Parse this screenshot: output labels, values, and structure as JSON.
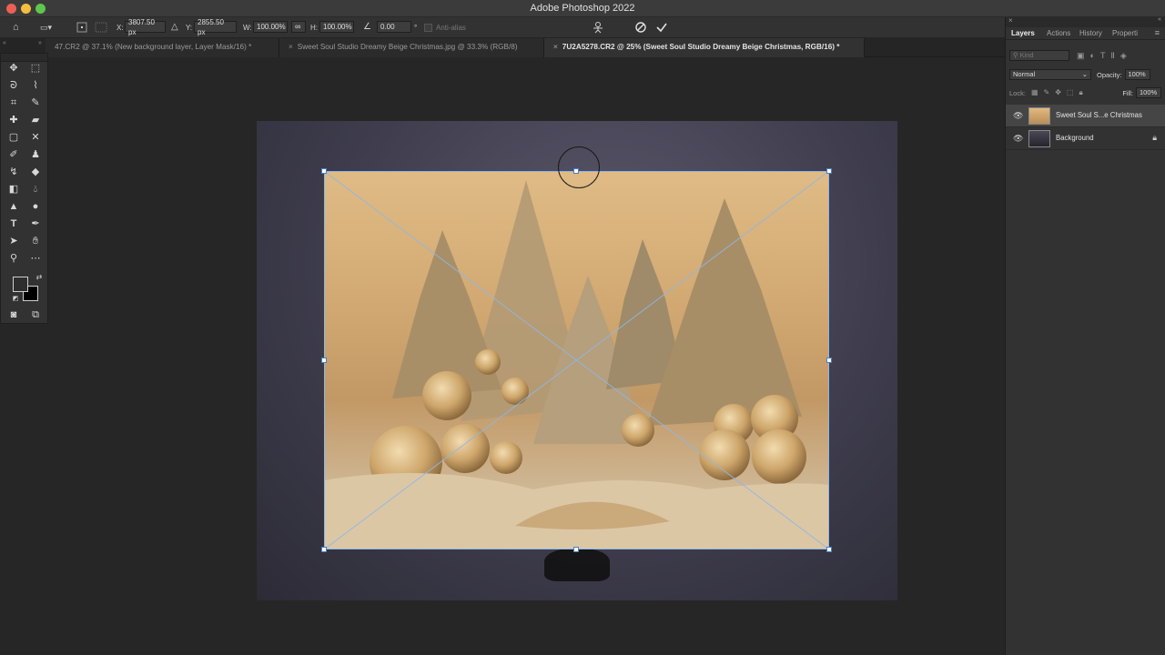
{
  "app": {
    "title": "Adobe Photoshop 2022"
  },
  "options_bar": {
    "x_label": "X:",
    "x_value": "3807.50 px",
    "y_label": "Y:",
    "y_value": "2855.50 px",
    "w_label": "W:",
    "w_value": "100.00%",
    "h_label": "H:",
    "h_value": "100.00%",
    "angle_value": "0.00",
    "degree_symbol": "°",
    "antialias_label": "Anti-alias",
    "icons": [
      "home-icon",
      "reference-point-icon",
      "link-icon",
      "angle-icon",
      "puppet-warp-icon",
      "cancel-icon",
      "commit-icon"
    ]
  },
  "tabs": [
    {
      "label": "47.CR2 @ 37.1% (New background layer, Layer Mask/16) *",
      "active": false
    },
    {
      "label": "Sweet Soul Studio Dreamy Beige Christmas.jpg @ 33.3% (RGB/8)",
      "active": false
    },
    {
      "label": "7U2A5278.CR2 @ 25% (Sweet Soul Studio Dreamy Beige Christmas, RGB/16) *",
      "active": true
    }
  ],
  "layers_panel": {
    "tabs": [
      "Layers",
      "Actions",
      "History",
      "Properti"
    ],
    "search_placeholder": "Kind",
    "blend_mode": "Normal",
    "opacity_label": "Opacity:",
    "opacity_value": "100%",
    "lock_label": "Lock:",
    "fill_label": "Fill:",
    "fill_value": "100%",
    "layers": [
      {
        "name": "Sweet Soul S...e Christmas",
        "visible": true,
        "selected": true,
        "locked": false
      },
      {
        "name": "Background",
        "visible": true,
        "selected": false,
        "locked": true
      }
    ]
  },
  "colors": {
    "foreground": "#2e2e2e",
    "background": "#000000",
    "selection_accent": "#8eb7e8"
  }
}
